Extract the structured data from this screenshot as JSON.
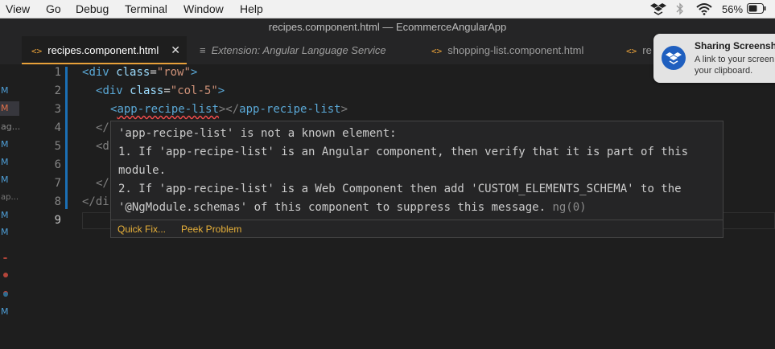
{
  "menubar": {
    "items": [
      "View",
      "Go",
      "Debug",
      "Terminal",
      "Window",
      "Help"
    ],
    "battery_percent": "56%"
  },
  "window": {
    "title": "recipes.component.html — EcommerceAngularApp"
  },
  "tabs": [
    {
      "label": "recipes.component.html",
      "icon": "angular-html-icon",
      "active": true
    },
    {
      "label": "Extension: Angular Language Service",
      "icon": "extension-icon"
    },
    {
      "label": "shopping-list.component.html",
      "icon": "angular-html-icon"
    },
    {
      "label": "re",
      "icon": "angular-html-icon"
    }
  ],
  "scm_gutter": [
    "M",
    "M",
    "ag...",
    "M",
    "M",
    "M",
    "ap...",
    "M",
    "M",
    "M"
  ],
  "editor": {
    "line_numbers": [
      "1",
      "2",
      "3",
      "4",
      "5",
      "6",
      "7",
      "8",
      "9"
    ],
    "lines": {
      "l1": {
        "open": "<",
        "tag": "div",
        "attr": "class",
        "eq": "=",
        "val": "\"row\"",
        "close": ">"
      },
      "l2": {
        "open": "<",
        "tag": "div",
        "attr": "class",
        "eq": "=",
        "val": "\"col-5\"",
        "close": ">"
      },
      "l3": {
        "open": "<",
        "tag": "app-recipe-list",
        "mid": "></",
        "tag2": "app-recipe-list",
        "close": ">"
      },
      "l4": "</",
      "l5": "<d",
      "l7": "</",
      "l8": "</di"
    }
  },
  "hover": {
    "message_line1": "'app-recipe-list' is not a known element:",
    "message_line2": "1. If 'app-recipe-list' is an Angular component, then verify that it is part of this module.",
    "message_line3": "2. If 'app-recipe-list' is a Web Component then add 'CUSTOM_ELEMENTS_SCHEMA' to the '@NgModule.schemas' of this component to suppress this message.",
    "code": "ng(0)",
    "actions": [
      "Quick Fix...",
      "Peek Problem"
    ]
  },
  "notification": {
    "title": "Sharing Screensh",
    "body": "A link to your screen your clipboard."
  },
  "colors": {
    "accent": "#e8a13a",
    "error": "#f14c4c",
    "modified": "#1b6fb5"
  }
}
